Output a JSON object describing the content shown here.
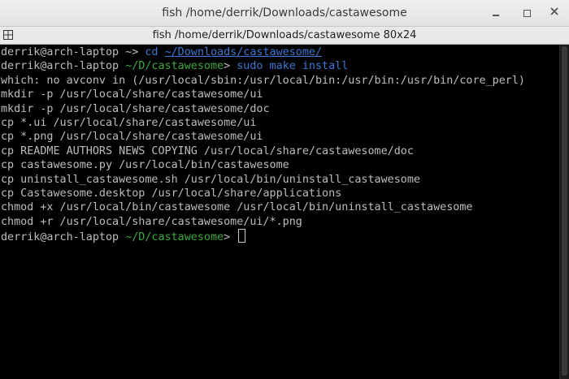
{
  "window": {
    "title": "fish  /home/derrik/Downloads/castawesome",
    "controls": {
      "minimize": "minimize-icon",
      "maximize": "maximize-icon",
      "close": "close-icon"
    }
  },
  "tab": {
    "title": "fish  /home/derrik/Downloads/castawesome 80x24"
  },
  "colors": {
    "background": "#000000",
    "text": "#bdbdbd",
    "prompt_path": "#3ea83e",
    "command": "#3b78d4"
  },
  "terminal": {
    "prompt1_user": "derrik@arch-laptop ~> ",
    "prompt1_cmd": "cd",
    "prompt1_arg": "~/Downloads/castawesome/",
    "prompt2_user": "derrik@arch-laptop ",
    "prompt2_path": "~/D/castawesome",
    "prompt2_sep": "> ",
    "prompt2_cmd": "sudo make install",
    "output": [
      "which: no avconv in (/usr/local/sbin:/usr/local/bin:/usr/bin:/usr/bin/core_perl)",
      "mkdir -p /usr/local/share/castawesome/ui",
      "mkdir -p /usr/local/share/castawesome/doc",
      "cp *.ui /usr/local/share/castawesome/ui",
      "cp *.png /usr/local/share/castawesome/ui",
      "cp README AUTHORS NEWS COPYING /usr/local/share/castawesome/doc",
      "cp castawesome.py /usr/local/bin/castawesome",
      "cp uninstall_castawesome.sh /usr/local/bin/uninstall_castawesome",
      "cp Castawesome.desktop /usr/local/share/applications",
      "chmod +x /usr/local/bin/castawesome /usr/local/bin/uninstall_castawesome",
      "chmod +r /usr/local/share/castawesome/ui/*.png"
    ],
    "prompt3_user": "derrik@arch-laptop ",
    "prompt3_path": "~/D/castawesome",
    "prompt3_sep": "> "
  }
}
